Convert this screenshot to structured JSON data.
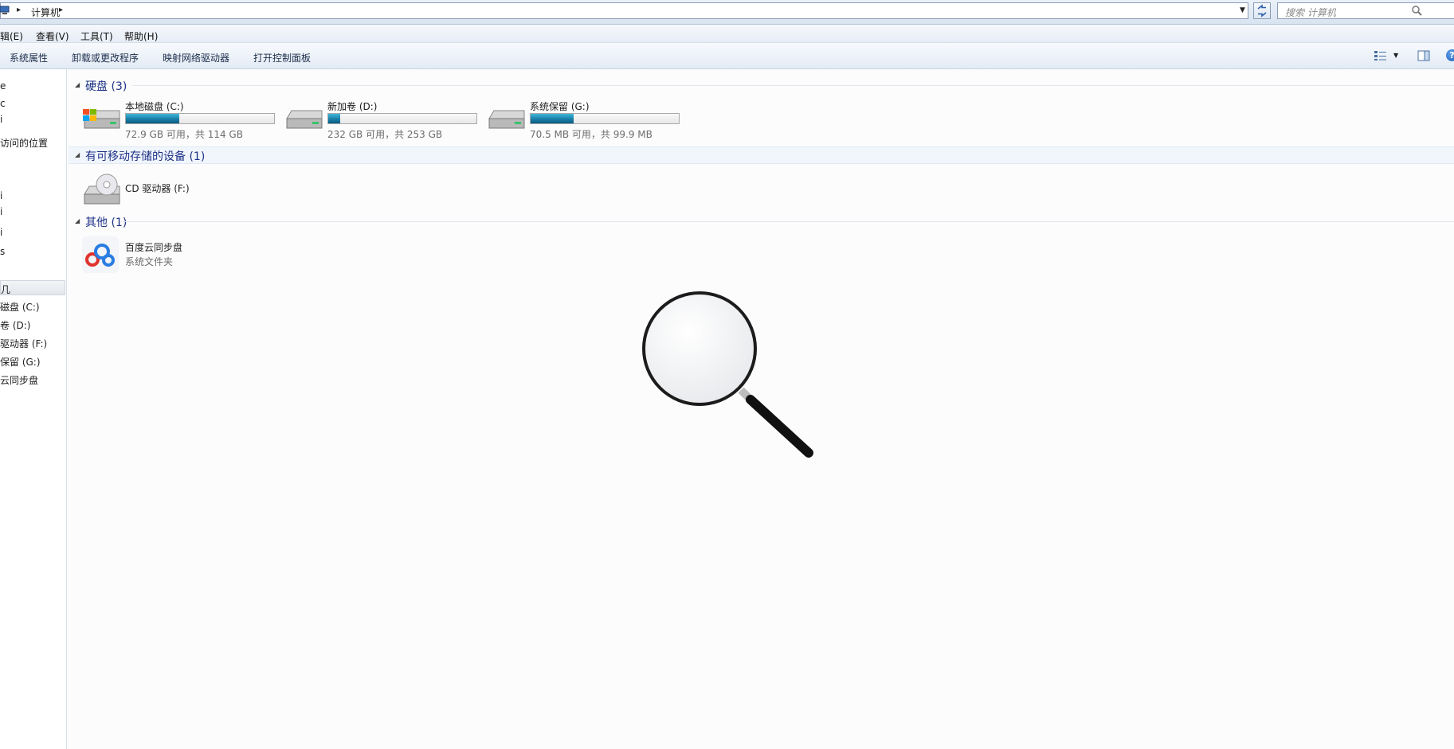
{
  "address": {
    "breadcrumb": "计算机",
    "search_placeholder": "搜索 计算机"
  },
  "menu": [
    {
      "label": "辑(E)"
    },
    {
      "label": "查看(V)"
    },
    {
      "label": "工具(T)"
    },
    {
      "label": "帮助(H)"
    }
  ],
  "toolbar": [
    {
      "label": "系统属性"
    },
    {
      "label": "卸载或更改程序"
    },
    {
      "label": "映射网络驱动器"
    },
    {
      "label": "打开控制面板"
    }
  ],
  "nav": [
    {
      "label": "e"
    },
    {
      "label": "c"
    },
    {
      "label": "i"
    },
    {
      "label": "访问的位置"
    },
    {
      "label": "i"
    },
    {
      "label": "i"
    },
    {
      "label": "i"
    },
    {
      "label": "s"
    },
    {
      "label": "几"
    },
    {
      "label": "磁盘 (C:)"
    },
    {
      "label": "卷 (D:)"
    },
    {
      "label": "驱动器 (F:)"
    },
    {
      "label": "保留 (G:)"
    },
    {
      "label": "云同步盘"
    }
  ],
  "groups": {
    "hdd": {
      "label": "硬盘 (3)"
    },
    "removable": {
      "label": "有可移动存储的设备 (1)"
    },
    "other": {
      "label": "其他 (1)"
    }
  },
  "drives": [
    {
      "name": "本地磁盘 (C:)",
      "info": "72.9 GB 可用，共 114 GB",
      "used_fraction": 0.36
    },
    {
      "name": "新加卷 (D:)",
      "info": "232 GB 可用，共 253 GB",
      "used_fraction": 0.08
    },
    {
      "name": "系统保留 (G:)",
      "info": "70.5 MB 可用，共 99.9 MB",
      "used_fraction": 0.29
    }
  ],
  "removable": [
    {
      "name": "CD 驱动器 (F:)"
    }
  ],
  "other": [
    {
      "name": "百度云同步盘",
      "type": "系统文件夹"
    }
  ],
  "colors": {
    "group_header": "#1e3287",
    "bar_fill": "#1a7fa8"
  }
}
